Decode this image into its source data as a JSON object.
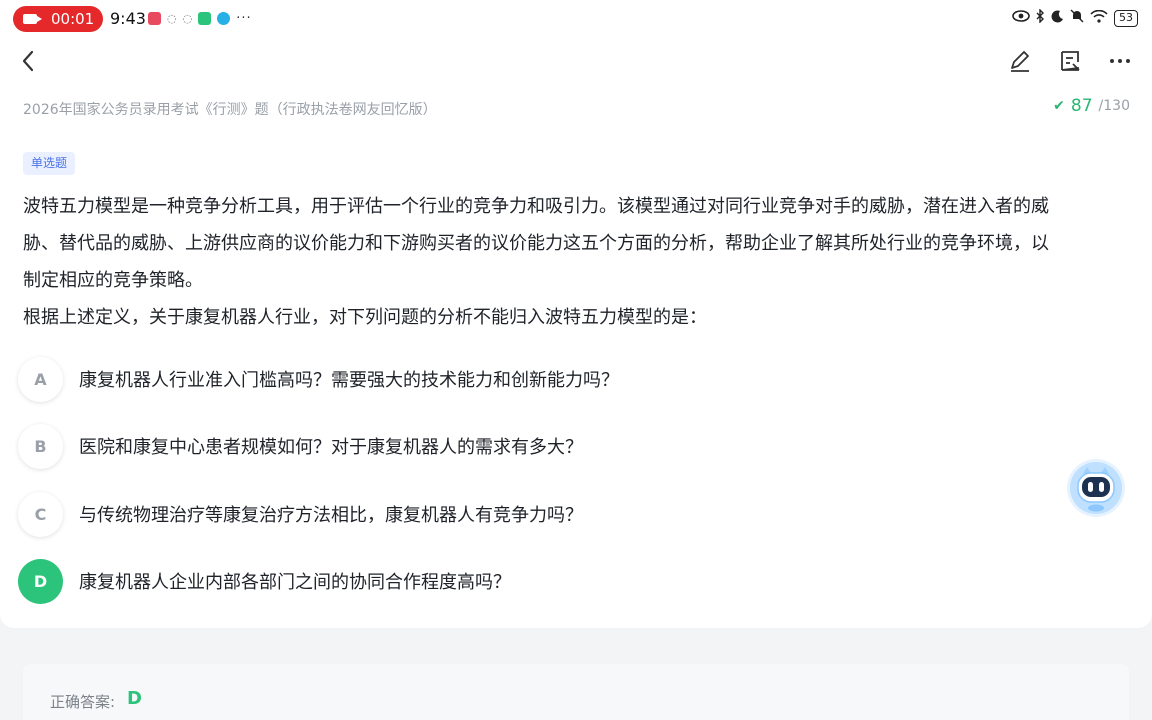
{
  "status_bar": {
    "recording_time": "00:01",
    "clock": "9:43",
    "battery": "53"
  },
  "header": {
    "exam_title": "2026年国家公务员录用考试《行测》题（行政执法卷网友回忆版）",
    "progress_current": "87",
    "progress_total": "/130"
  },
  "question": {
    "type": "单选题",
    "stem_lines": [
      "波特五力模型是一种竞争分析工具，用于评估一个行业的竞争力和吸引力。该模型通过对同行业竞争对手的威胁，潜在进入者的威",
      "胁、替代品的威胁、上游供应商的议价能力和下游购买者的议价能力这五个方面的分析，帮助企业了解其所处行业的竞争环境，以",
      "制定相应的竞争策略。",
      "根据上述定义，关于康复机器人行业，对下列问题的分析不能归入波特五力模型的是："
    ],
    "options": [
      {
        "letter": "A",
        "text": "康复机器人行业准入门槛高吗？需要强大的技术能力和创新能力吗？"
      },
      {
        "letter": "B",
        "text": "医院和康复中心患者规模如何？对于康复机器人的需求有多大？"
      },
      {
        "letter": "C",
        "text": "与传统物理治疗等康复治疗方法相比，康复机器人有竞争力吗？"
      },
      {
        "letter": "D",
        "text": "康复机器人企业内部各部门之间的协同合作程度高吗？"
      }
    ]
  },
  "answer": {
    "label": "正确答案:",
    "value": "D"
  },
  "colors": {
    "accent_green": "#2bc47a",
    "record_red": "#e5292b",
    "tag_blue": "#4a72e8"
  }
}
